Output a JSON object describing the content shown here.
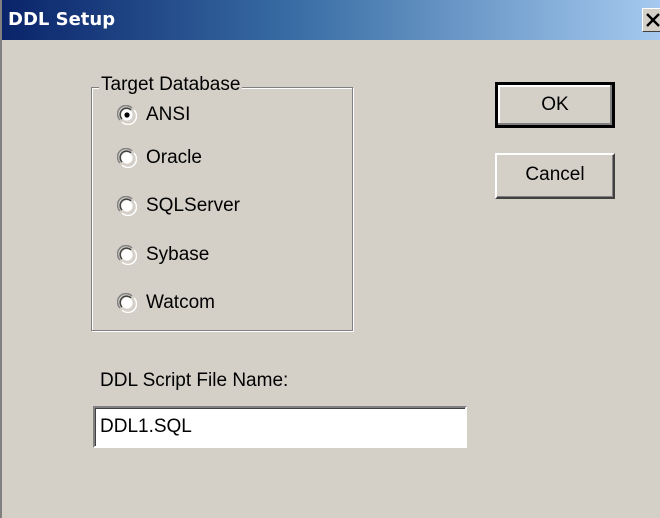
{
  "window": {
    "title": "DDL Setup",
    "close_symbol": "X"
  },
  "target_database": {
    "legend": "Target Database",
    "options": [
      {
        "label": "ANSI",
        "selected": true
      },
      {
        "label": "Oracle",
        "selected": false
      },
      {
        "label": "SQLServer",
        "selected": false
      },
      {
        "label": "Sybase",
        "selected": false
      },
      {
        "label": "Watcom",
        "selected": false
      }
    ]
  },
  "buttons": {
    "ok_label": "OK",
    "cancel_label": "Cancel"
  },
  "script_file": {
    "label": "DDL Script File Name:",
    "value": "DDL1.SQL"
  },
  "colors": {
    "title_gradient_start": "#0a246a",
    "title_gradient_end": "#a6caf0",
    "dialog_face": "#d4d0c8"
  }
}
